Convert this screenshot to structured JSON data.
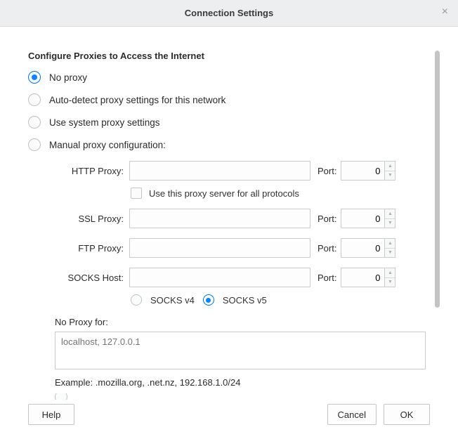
{
  "dialog": {
    "title": "Connection Settings",
    "close_label": "×"
  },
  "section": {
    "heading": "Configure Proxies to Access the Internet"
  },
  "radios": {
    "no_proxy": "No proxy",
    "auto_detect": "Auto-detect proxy settings for this network",
    "use_system": "Use system proxy settings",
    "manual": "Manual proxy configuration:"
  },
  "manual": {
    "http_label": "HTTP Proxy:",
    "ssl_label": "SSL Proxy:",
    "ftp_label": "FTP Proxy:",
    "socks_label": "SOCKS Host:",
    "port_label": "Port:",
    "http_value": "",
    "ssl_value": "",
    "ftp_value": "",
    "socks_value": "",
    "http_port": "0",
    "ssl_port": "0",
    "ftp_port": "0",
    "socks_port": "0",
    "use_for_all_label": "Use this proxy server for all protocols",
    "socks_v4": "SOCKS v4",
    "socks_v5": "SOCKS v5"
  },
  "noproxy": {
    "label": "No Proxy for:",
    "placeholder": "localhost, 127.0.0.1",
    "value": "",
    "example": "Example: .mozilla.org, .net.nz, 192.168.1.0/24"
  },
  "footer": {
    "help": "Help",
    "cancel": "Cancel",
    "ok": "OK"
  }
}
